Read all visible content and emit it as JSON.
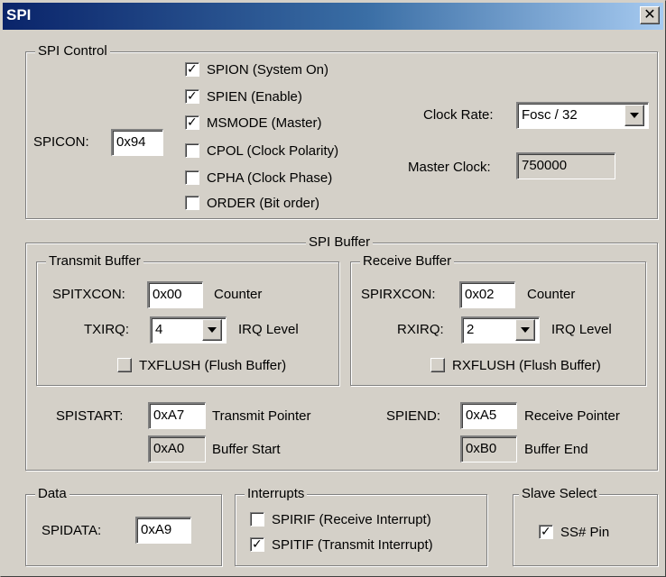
{
  "window": {
    "title": "SPI",
    "close_glyph": "✕"
  },
  "spi_control": {
    "legend": "SPI Control",
    "spicon_label": "SPICON:",
    "spicon_value": "0x94",
    "flags": [
      {
        "label": "SPION (System On)",
        "checked": true
      },
      {
        "label": "SPIEN (Enable)",
        "checked": true
      },
      {
        "label": "MSMODE (Master)",
        "checked": true
      },
      {
        "label": "CPOL (Clock Polarity)",
        "checked": false
      },
      {
        "label": "CPHA (Clock Phase)",
        "checked": false
      },
      {
        "label": "ORDER (Bit order)",
        "checked": false
      }
    ],
    "clock_rate_label": "Clock Rate:",
    "clock_rate_value": "Fosc / 32",
    "master_clock_label": "Master Clock:",
    "master_clock_value": "750000"
  },
  "spi_buffer": {
    "legend": "SPI Buffer",
    "transmit": {
      "legend": "Transmit Buffer",
      "con_label": "SPITXCON:",
      "con_value": "0x00",
      "con_desc": "Counter",
      "irq_label": "TXIRQ:",
      "irq_value": "4",
      "irq_desc": "IRQ Level",
      "flush_label": "TXFLUSH (Flush Buffer)"
    },
    "receive": {
      "legend": "Receive Buffer",
      "con_label": "SPIRXCON:",
      "con_value": "0x02",
      "con_desc": "Counter",
      "irq_label": "RXIRQ:",
      "irq_value": "2",
      "irq_desc": "IRQ Level",
      "flush_label": "RXFLUSH (Flush Buffer)"
    },
    "start_label": "SPISTART:",
    "start_value": "0xA7",
    "start_desc": "Transmit Pointer",
    "buffer_start_value": "0xA0",
    "buffer_start_desc": "Buffer Start",
    "end_label": "SPIEND:",
    "end_value": "0xA5",
    "end_desc": "Receive Pointer",
    "buffer_end_value": "0xB0",
    "buffer_end_desc": "Buffer End"
  },
  "data": {
    "legend": "Data",
    "spidata_label": "SPIDATA:",
    "spidata_value": "0xA9"
  },
  "interrupts": {
    "legend": "Interrupts",
    "items": [
      {
        "label": "SPIRIF (Receive Interrupt)",
        "checked": false
      },
      {
        "label": "SPITIF (Transmit Interrupt)",
        "checked": true
      }
    ]
  },
  "slave_select": {
    "legend": "Slave Select",
    "ss_label": "SS# Pin",
    "ss_checked": true
  },
  "icons": {
    "checkmark": "✓",
    "dropdown": "chevron-down-icon",
    "close": "close-icon"
  }
}
